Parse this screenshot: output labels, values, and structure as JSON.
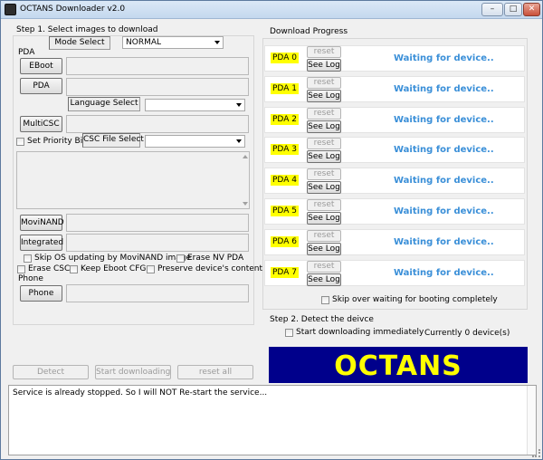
{
  "window": {
    "title": "OCTANS Downloader v2.0",
    "minimize": "–",
    "maximize": "□",
    "close": "✕"
  },
  "step1": {
    "heading": "Step 1. Select images to download",
    "mode_select_label": "Mode Select",
    "mode_value": "NORMAL",
    "pda_group_label": "PDA",
    "eboot_button": "EBoot",
    "pda_button": "PDA",
    "language_select_label": "Language Select",
    "language_value": "",
    "multicsc_button": "MultiCSC",
    "set_priority_label": "Set Priority Bit",
    "csc_file_select_label": "CSC File Select",
    "csc_value": "",
    "movinand_button": "MoviNAND",
    "integrated_button": "Integrated",
    "options": {
      "skip_os": "Skip OS updating by MoviNAND image",
      "erase_nv": "Erase NV PDA",
      "erase_csc": "Erase CSC",
      "keep_eboot": "Keep Eboot CFG",
      "preserve": "Preserve device's contents"
    },
    "phone_group_label": "Phone",
    "phone_button": "Phone"
  },
  "actions": {
    "detect": "Detect",
    "start_downloading": "Start downloading",
    "reset_all": "reset all"
  },
  "progress": {
    "heading": "Download Progress",
    "reset_label": "reset",
    "see_log_label": "See Log",
    "rows": [
      {
        "name": "PDA 0",
        "status": "Waiting for device.."
      },
      {
        "name": "PDA 1",
        "status": "Waiting for device.."
      },
      {
        "name": "PDA 2",
        "status": "Waiting for device.."
      },
      {
        "name": "PDA 3",
        "status": "Waiting for device.."
      },
      {
        "name": "PDA 4",
        "status": "Waiting for device.."
      },
      {
        "name": "PDA 5",
        "status": "Waiting for device.."
      },
      {
        "name": "PDA 6",
        "status": "Waiting for device.."
      },
      {
        "name": "PDA 7",
        "status": "Waiting for device.."
      }
    ],
    "skip_waiting": "Skip over waiting for booting completely"
  },
  "step2": {
    "heading": "Step 2. Detect the deivce",
    "start_immediately": "Start downloading immediately",
    "device_count": "Currently 0 device(s)"
  },
  "logo": {
    "text": "OCTANS",
    "bg_color": "#00008b",
    "text_color": "#ffff00"
  },
  "status": {
    "message": "Service is already stopped. So I will NOT Re-start the service..."
  },
  "colors": {
    "status_text": "#3a8fd8",
    "pda_highlight": "#ffff00"
  }
}
